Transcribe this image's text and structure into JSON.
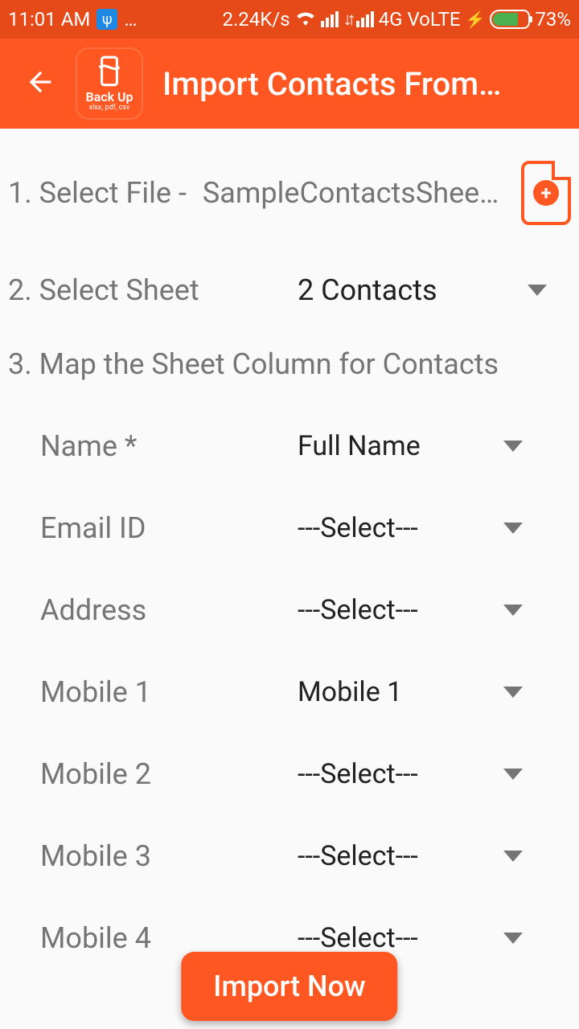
{
  "status": {
    "time": "11:01 AM",
    "speed": "2.24K/s",
    "network": "4G",
    "volte": "VoLTE",
    "battery_pct": "73%"
  },
  "header": {
    "title": "Import Contacts From…",
    "icon_label_top": "Back Up",
    "icon_label_bottom": "xlsx, pdf, csv"
  },
  "step1": {
    "label": "1. Select File  -",
    "filename": "SampleContactsShee…"
  },
  "step2": {
    "label": "2. Select Sheet",
    "value": "2 Contacts"
  },
  "step3": {
    "title": "3. Map the Sheet Column for Contacts"
  },
  "fields": {
    "name": {
      "label": "Name *",
      "value": "Full Name"
    },
    "email": {
      "label": "Email ID",
      "value": "---Select---"
    },
    "address": {
      "label": "Address",
      "value": "---Select---"
    },
    "mobile1": {
      "label": "Mobile 1",
      "value": "Mobile 1"
    },
    "mobile2": {
      "label": "Mobile 2",
      "value": "---Select---"
    },
    "mobile3": {
      "label": "Mobile 3",
      "value": "---Select---"
    },
    "mobile4": {
      "label": "Mobile 4",
      "value": "---Select---"
    }
  },
  "import_button": "Import Now"
}
